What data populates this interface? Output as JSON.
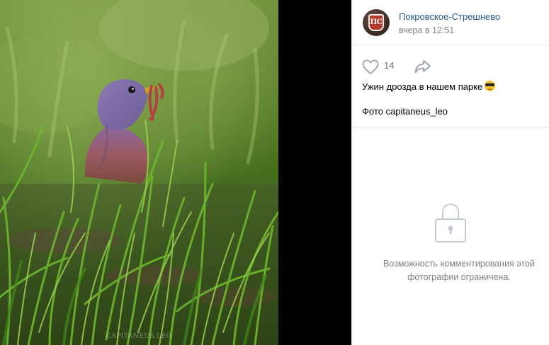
{
  "photo": {
    "watermark": "CAPITANEUS.LEO"
  },
  "post": {
    "group_name": "Покровское-Стрешнево",
    "time": "вчера в 12:51",
    "likes": "14",
    "text_line1": "Ужин дрозда в нашем парке",
    "emoji": "smiling-face-with-sunglasses",
    "text_line2": "Фото capitaneus_leo"
  },
  "avatar": {
    "text": "ПС"
  },
  "comments": {
    "locked_message": "Возможность комментирования этой фотографии ограничена."
  },
  "colors": {
    "link": "#2a5885",
    "muted": "#828282",
    "divider": "#e7e8ec"
  }
}
